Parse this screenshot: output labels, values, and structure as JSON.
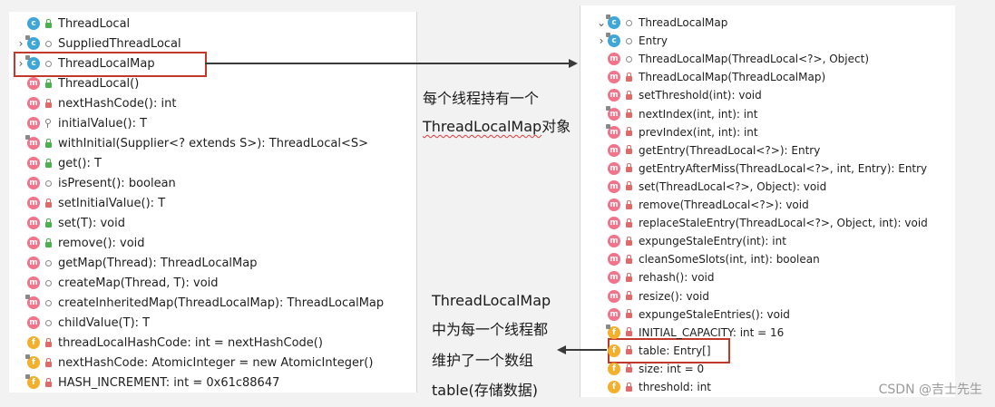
{
  "left_tree": [
    {
      "chevron": "",
      "icon": "c",
      "static": false,
      "vis": "green",
      "label": "ThreadLocal"
    },
    {
      "chevron": "›",
      "icon": "c",
      "static": true,
      "vis": "circle",
      "label": "SuppliedThreadLocal"
    },
    {
      "chevron": "›",
      "icon": "c",
      "static": true,
      "vis": "circle",
      "label": "ThreadLocalMap"
    },
    {
      "chevron": "",
      "icon": "m",
      "static": false,
      "vis": "green",
      "label": "ThreadLocal()"
    },
    {
      "chevron": "",
      "icon": "m",
      "static": false,
      "vis": "red",
      "label": "nextHashCode(): int"
    },
    {
      "chevron": "",
      "icon": "m",
      "static": false,
      "vis": "key",
      "label": "initialValue(): T"
    },
    {
      "chevron": "",
      "icon": "m",
      "static": true,
      "vis": "green",
      "label": "withInitial(Supplier<? extends S>): ThreadLocal<S>"
    },
    {
      "chevron": "",
      "icon": "m",
      "static": false,
      "vis": "green",
      "label": "get(): T"
    },
    {
      "chevron": "",
      "icon": "m",
      "static": false,
      "vis": "circle",
      "label": "isPresent(): boolean"
    },
    {
      "chevron": "",
      "icon": "m",
      "static": false,
      "vis": "red",
      "label": "setInitialValue(): T"
    },
    {
      "chevron": "",
      "icon": "m",
      "static": false,
      "vis": "green",
      "label": "set(T): void"
    },
    {
      "chevron": "",
      "icon": "m",
      "static": false,
      "vis": "green",
      "label": "remove(): void"
    },
    {
      "chevron": "",
      "icon": "m",
      "static": false,
      "vis": "circle",
      "label": "getMap(Thread): ThreadLocalMap"
    },
    {
      "chevron": "",
      "icon": "m",
      "static": false,
      "vis": "circle",
      "label": "createMap(Thread, T): void"
    },
    {
      "chevron": "",
      "icon": "m",
      "static": true,
      "vis": "circle",
      "label": "createInheritedMap(ThreadLocalMap): ThreadLocalMap"
    },
    {
      "chevron": "",
      "icon": "m",
      "static": false,
      "vis": "circle",
      "label": "childValue(T): T"
    },
    {
      "chevron": "",
      "icon": "f",
      "static": false,
      "vis": "red",
      "label": "threadLocalHashCode: int = nextHashCode()"
    },
    {
      "chevron": "",
      "icon": "f",
      "static": true,
      "vis": "red",
      "label": "nextHashCode: AtomicInteger = new AtomicInteger()"
    },
    {
      "chevron": "",
      "icon": "f",
      "static": true,
      "vis": "red",
      "label": "HASH_INCREMENT: int = 0x61c88647"
    }
  ],
  "right_tree": [
    {
      "chevron": "⌄",
      "icon": "c",
      "static": true,
      "vis": "circle",
      "label": "ThreadLocalMap"
    },
    {
      "chevron": "›",
      "icon": "c",
      "static": true,
      "vis": "circle",
      "label": "Entry"
    },
    {
      "chevron": "",
      "icon": "m",
      "static": false,
      "vis": "circle",
      "label": "ThreadLocalMap(ThreadLocal<?>, Object)"
    },
    {
      "chevron": "",
      "icon": "m",
      "static": false,
      "vis": "red",
      "label": "ThreadLocalMap(ThreadLocalMap)"
    },
    {
      "chevron": "",
      "icon": "m",
      "static": false,
      "vis": "red",
      "label": "setThreshold(int): void"
    },
    {
      "chevron": "",
      "icon": "m",
      "static": true,
      "vis": "red",
      "label": "nextIndex(int, int): int"
    },
    {
      "chevron": "",
      "icon": "m",
      "static": true,
      "vis": "red",
      "label": "prevIndex(int, int): int"
    },
    {
      "chevron": "",
      "icon": "m",
      "static": false,
      "vis": "red",
      "label": "getEntry(ThreadLocal<?>): Entry"
    },
    {
      "chevron": "",
      "icon": "m",
      "static": false,
      "vis": "red",
      "label": "getEntryAfterMiss(ThreadLocal<?>, int, Entry): Entry"
    },
    {
      "chevron": "",
      "icon": "m",
      "static": false,
      "vis": "red",
      "label": "set(ThreadLocal<?>, Object): void"
    },
    {
      "chevron": "",
      "icon": "m",
      "static": false,
      "vis": "red",
      "label": "remove(ThreadLocal<?>): void"
    },
    {
      "chevron": "",
      "icon": "m",
      "static": false,
      "vis": "red",
      "label": "replaceStaleEntry(ThreadLocal<?>, Object, int): void"
    },
    {
      "chevron": "",
      "icon": "m",
      "static": false,
      "vis": "red",
      "label": "expungeStaleEntry(int): int"
    },
    {
      "chevron": "",
      "icon": "m",
      "static": false,
      "vis": "red",
      "label": "cleanSomeSlots(int, int): boolean"
    },
    {
      "chevron": "",
      "icon": "m",
      "static": false,
      "vis": "red",
      "label": "rehash(): void"
    },
    {
      "chevron": "",
      "icon": "m",
      "static": false,
      "vis": "red",
      "label": "resize(): void"
    },
    {
      "chevron": "",
      "icon": "m",
      "static": false,
      "vis": "red",
      "label": "expungeStaleEntries(): void"
    },
    {
      "chevron": "",
      "icon": "f",
      "static": true,
      "vis": "red",
      "label": "INITIAL_CAPACITY: int = 16"
    },
    {
      "chevron": "",
      "icon": "f",
      "static": false,
      "vis": "red",
      "label": "table: Entry[]"
    },
    {
      "chevron": "",
      "icon": "f",
      "static": false,
      "vis": "red",
      "label": "size: int = 0"
    },
    {
      "chevron": "",
      "icon": "f",
      "static": false,
      "vis": "red",
      "label": "threshold: int"
    }
  ],
  "annotation_top": {
    "line1": "每个线程持有一个",
    "line2_code": "ThreadLocalMap",
    "line2_suffix": "对象"
  },
  "annotation_bottom": {
    "line1": "ThreadLocalMap",
    "line2": "中为每一个线程都",
    "line3": "维护了一个数组",
    "line4": "table(存储数据)"
  },
  "watermark": "CSDN @吉士先生"
}
